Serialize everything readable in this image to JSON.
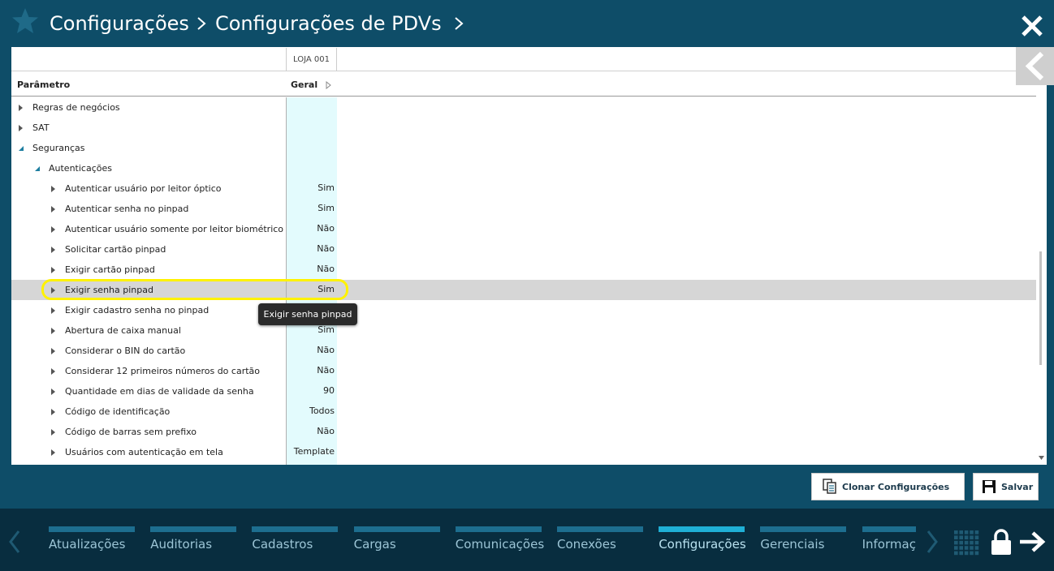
{
  "header": {
    "crumbs": [
      "Configurações",
      "Configurações de PDVs"
    ]
  },
  "table": {
    "store_header": "LOJA 001",
    "col_param": "Parâmetro",
    "col_geral": "Geral",
    "rows": [
      {
        "label": "Regras de negócios",
        "value": "",
        "level": 0,
        "expanded": false
      },
      {
        "label": "SAT",
        "value": "",
        "level": 0,
        "expanded": false
      },
      {
        "label": "Seguranças",
        "value": "",
        "level": 0,
        "expanded": true
      },
      {
        "label": "Autenticações",
        "value": "",
        "level": 1,
        "expanded": true
      },
      {
        "label": "Autenticar usuário por leitor óptico",
        "value": "Sim",
        "level": 2,
        "expanded": false
      },
      {
        "label": "Autenticar senha no pinpad",
        "value": "Sim",
        "level": 2,
        "expanded": false
      },
      {
        "label": "Autenticar usuário somente por leitor biométrico",
        "value": "Não",
        "level": 2,
        "expanded": false
      },
      {
        "label": "Solicitar cartão pinpad",
        "value": "Não",
        "level": 2,
        "expanded": false
      },
      {
        "label": "Exigir cartão pinpad",
        "value": "Não",
        "level": 2,
        "expanded": false
      },
      {
        "label": "Exigir senha pinpad",
        "value": "Sim",
        "level": 2,
        "expanded": false,
        "selected": true
      },
      {
        "label": "Exigir cadastro senha no pinpad",
        "value": "",
        "level": 2,
        "expanded": false
      },
      {
        "label": "Abertura de caixa manual",
        "value": "Sim",
        "level": 2,
        "expanded": false
      },
      {
        "label": "Considerar o BIN do cartão",
        "value": "Não",
        "level": 2,
        "expanded": false
      },
      {
        "label": "Considerar 12 primeiros números do cartão",
        "value": "Não",
        "level": 2,
        "expanded": false
      },
      {
        "label": "Quantidade em dias de validade da senha",
        "value": "90",
        "level": 2,
        "expanded": false
      },
      {
        "label": "Código de identificação",
        "value": "Todos",
        "level": 2,
        "expanded": false
      },
      {
        "label": "Código de barras sem prefixo",
        "value": "Não",
        "level": 2,
        "expanded": false
      },
      {
        "label": "Usuários com autenticação em tela",
        "value": "Template",
        "level": 2,
        "expanded": false
      }
    ]
  },
  "tooltip": "Exigir senha pinpad",
  "actions": {
    "clone_label": "Clonar Configurações",
    "save_label": "Salvar"
  },
  "nav": {
    "tabs": [
      "Atualizações",
      "Auditorias",
      "Cadastros",
      "Cargas",
      "Comunicações",
      "Conexões",
      "Configurações",
      "Gerenciais",
      "Informações"
    ],
    "active_tab": "Configurações"
  },
  "colors": {
    "background": "#0e4d68",
    "bottom_nav": "#082d3f",
    "tab_bar": "#1d6e8f",
    "tab_bar_active": "#1fb0d6",
    "highlight": "#fff200",
    "value_column": "#e3fbfd",
    "selected_row": "#d6d6d6"
  },
  "icons": {
    "star": "star-icon",
    "close": "close-icon",
    "collapse_panel": "chevron-left-icon",
    "clone": "clone-icon",
    "save": "floppy-disk-icon",
    "grid": "grid-icon",
    "lock": "lock-icon",
    "logout": "arrow-right-icon"
  }
}
